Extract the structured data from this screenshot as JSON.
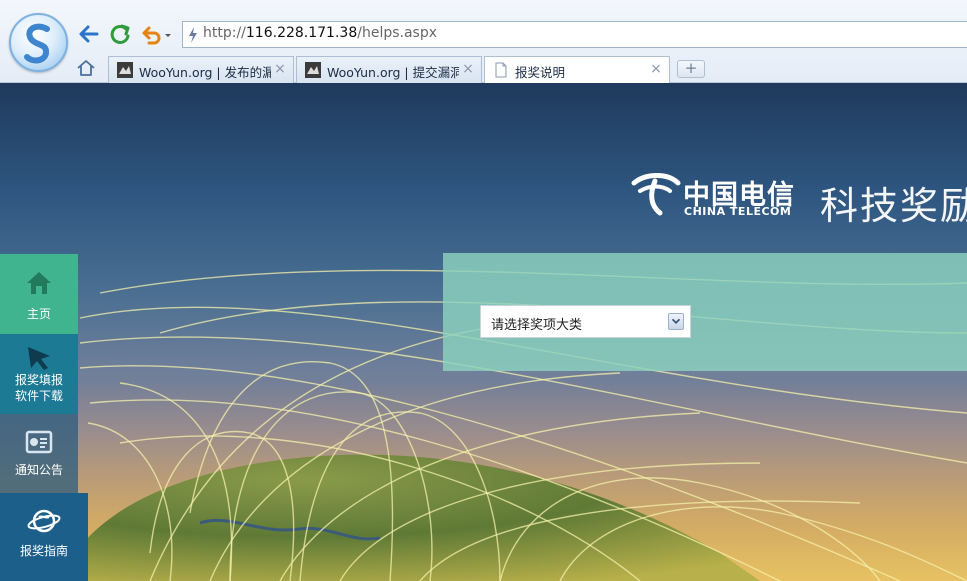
{
  "browser": {
    "address": {
      "scheme": "http://",
      "host": "116.228.171.38",
      "path": "/helps.aspx"
    },
    "tabs": [
      {
        "title": "WooYun.org | 发布的漏",
        "active": false
      },
      {
        "title": "WooYun.org | 提交漏洞",
        "active": false
      },
      {
        "title": "报奖说明",
        "active": true
      }
    ],
    "new_tab_label": "+",
    "close_label": "×"
  },
  "brand": {
    "name_cn": "中国电信",
    "name_en": "CHINA TELECOM",
    "title": "科技奖励"
  },
  "form": {
    "category_select": {
      "selected": "请选择奖项大类"
    }
  },
  "sidebar": {
    "items": [
      {
        "label_line1": "主页",
        "label_line2": "",
        "icon": "home-icon"
      },
      {
        "label_line1": "报奖填报",
        "label_line2": "软件下载",
        "icon": "cursor-icon"
      },
      {
        "label_line1": "通知公告",
        "label_line2": "",
        "icon": "notice-board-icon"
      },
      {
        "label_line1": "报奖指南",
        "label_line2": "",
        "icon": "globe-icon"
      }
    ]
  },
  "colors": {
    "nav_home": "#3fb48f",
    "nav_download": "#1c7a95",
    "nav_guide": "#1c5f8a",
    "panel": "#8cd2be"
  }
}
